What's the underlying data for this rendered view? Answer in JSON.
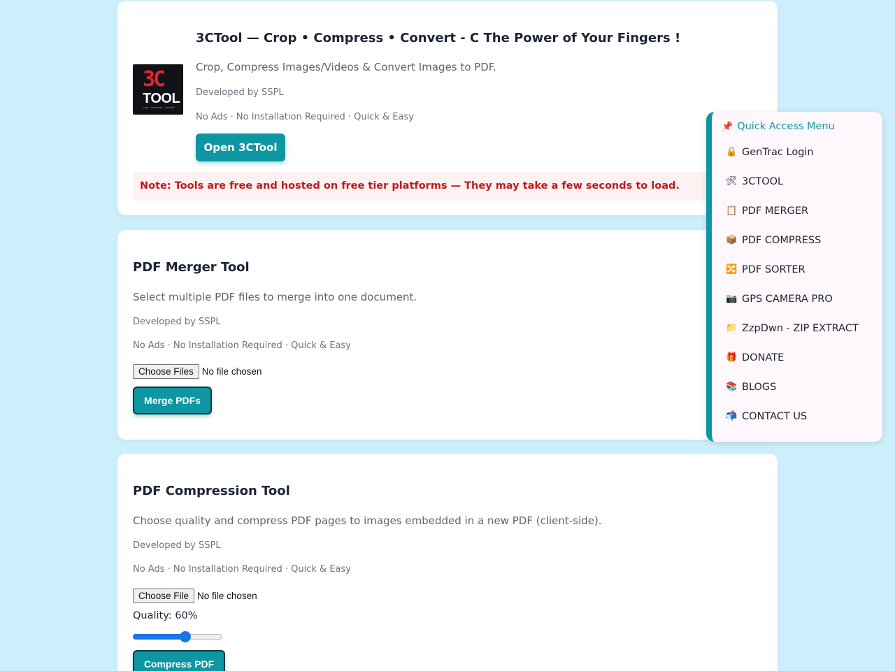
{
  "tool_3c": {
    "logo_big": "3C",
    "logo_word": "TOOL",
    "logo_tiny": "crop · compress · convert",
    "title": "3CTool — Crop • Compress • Convert - C The Power of Your Fingers !",
    "description": "Crop, Compress Images/Videos & Convert Images to PDF.",
    "developer": "Developed by SSPL",
    "features": "No Ads · No Installation Required · Quick & Easy",
    "button": "Open 3CTool",
    "note": "Note: Tools are free and hosted on free tier platforms — They may take a few seconds to load."
  },
  "merger": {
    "title": "PDF Merger Tool",
    "description": "Select multiple PDF files to merge into one document.",
    "developer": "Developed by SSPL",
    "features": "No Ads · No Installation Required · Quick & Easy",
    "file_button": "Choose Files",
    "file_status": "No file chosen",
    "action_button": "Merge PDFs"
  },
  "compress": {
    "title": "PDF Compression Tool",
    "description": "Choose quality and compress PDF pages to images embedded in a new PDF (client-side).",
    "developer": "Developed by SSPL",
    "features": "No Ads · No Installation Required · Quick & Easy",
    "file_button": "Choose File",
    "file_status": "No file chosen",
    "quality_label": "Quality: 60%",
    "quality_value": 0.6,
    "action_button": "Compress PDF"
  },
  "quick_access": {
    "title": "Quick Access Menu",
    "pin_icon": "pushpin-icon",
    "items": [
      {
        "label": "GenTrac Login",
        "icon": "lock-icon",
        "glyph": "🔒"
      },
      {
        "label": "3CTOOL",
        "icon": "tools-icon",
        "glyph": "🛠"
      },
      {
        "label": "PDF MERGER",
        "icon": "clipboard-icon",
        "glyph": "📋"
      },
      {
        "label": "PDF COMPRESS",
        "icon": "package-icon",
        "glyph": "📦"
      },
      {
        "label": "PDF SORTER",
        "icon": "shuffle-icon",
        "glyph": "🔀"
      },
      {
        "label": "GPS CAMERA PRO",
        "icon": "camera-icon",
        "glyph": "📷"
      },
      {
        "label": "ZzpDwn - ZIP EXTRACT",
        "icon": "zip-folder-icon",
        "glyph": "📁"
      },
      {
        "label": "DONATE",
        "icon": "gift-icon",
        "glyph": "🎁"
      },
      {
        "label": "BLOGS",
        "icon": "books-icon",
        "glyph": "📚"
      },
      {
        "label": "CONTACT US",
        "icon": "mailbox-icon",
        "glyph": "📬"
      }
    ]
  },
  "colors": {
    "accent": "#0e97a3",
    "note_red": "#c01b1b",
    "background": "#cdeefb"
  }
}
